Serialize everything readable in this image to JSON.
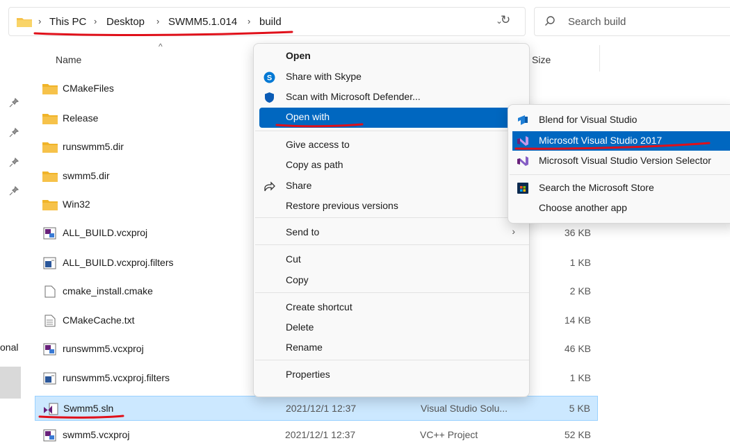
{
  "breadcrumb": [
    "This PC",
    "Desktop",
    "SWMM5.1.014",
    "build"
  ],
  "search": {
    "placeholder": "Search build"
  },
  "nav": {
    "partial_label": "onal"
  },
  "columns": {
    "name": "Name",
    "size": "Size"
  },
  "files": [
    {
      "name": "CMakeFiles",
      "icon": "folder-icon",
      "date": "",
      "type": "",
      "size": ""
    },
    {
      "name": "Release",
      "icon": "folder-icon",
      "date": "",
      "type": "",
      "size": ""
    },
    {
      "name": "runswmm5.dir",
      "icon": "folder-icon",
      "date": "",
      "type": "",
      "size": ""
    },
    {
      "name": "swmm5.dir",
      "icon": "folder-icon",
      "date": "",
      "type": "",
      "size": ""
    },
    {
      "name": "Win32",
      "icon": "folder-icon",
      "date": "",
      "type": "",
      "size": ""
    },
    {
      "name": "ALL_BUILD.vcxproj",
      "icon": "vcxproj-icon",
      "date": "",
      "type": "",
      "size": "36 KB"
    },
    {
      "name": "ALL_BUILD.vcxproj.filters",
      "icon": "filters-icon",
      "date": "",
      "type": "..",
      "size": "1 KB"
    },
    {
      "name": "cmake_install.cmake",
      "icon": "file-icon",
      "date": "",
      "type": "",
      "size": "2 KB"
    },
    {
      "name": "CMakeCache.txt",
      "icon": "text-file-icon",
      "date": "",
      "type": "",
      "size": "14 KB"
    },
    {
      "name": "runswmm5.vcxproj",
      "icon": "vcxproj-icon",
      "date": "",
      "type": "",
      "size": "46 KB"
    },
    {
      "name": "runswmm5.vcxproj.filters",
      "icon": "filters-icon",
      "date": "",
      "type": "..",
      "size": "1 KB"
    },
    {
      "name": "Swmm5.sln",
      "icon": "sln-icon",
      "date": "2021/12/1 12:37",
      "type": "Visual Studio Solu...",
      "size": "5 KB",
      "selected": true
    },
    {
      "name": "swmm5.vcxproj",
      "icon": "vcxproj-icon",
      "date": "2021/12/1 12:37",
      "type": "VC++ Project",
      "size": "52 KB"
    }
  ],
  "context_menu": [
    {
      "label": "Open",
      "bold": true,
      "icon": ""
    },
    {
      "label": "Share with Skype",
      "icon": "skype-icon"
    },
    {
      "label": "Scan with Microsoft Defender...",
      "icon": "defender-shield-icon"
    },
    {
      "label": "Open with",
      "submenu": true,
      "highlighted": true
    },
    {
      "label": "Give access to",
      "submenu": true
    },
    {
      "label": "Copy as path"
    },
    {
      "label": "Share",
      "icon": "share-icon"
    },
    {
      "label": "Restore previous versions"
    },
    {
      "label": "Send to",
      "submenu": true
    },
    {
      "label": "Cut"
    },
    {
      "label": "Copy"
    },
    {
      "label": "Create shortcut"
    },
    {
      "label": "Delete"
    },
    {
      "label": "Rename"
    },
    {
      "label": "Properties"
    }
  ],
  "open_with_menu": [
    {
      "label": "Blend for Visual Studio",
      "icon": "blend-icon"
    },
    {
      "label": "Microsoft Visual Studio 2017",
      "icon": "visual-studio-icon",
      "highlighted": true
    },
    {
      "label": "Microsoft Visual Studio Version Selector",
      "icon": "vs-version-selector-icon"
    },
    {
      "label": "Search the Microsoft Store",
      "icon": "microsoft-store-icon"
    },
    {
      "label": "Choose another app",
      "icon": ""
    }
  ],
  "colors": {
    "accent": "#0067c0",
    "selection": "#cce8ff",
    "annotation": "#e0101a",
    "folder": "#f6c24a"
  }
}
